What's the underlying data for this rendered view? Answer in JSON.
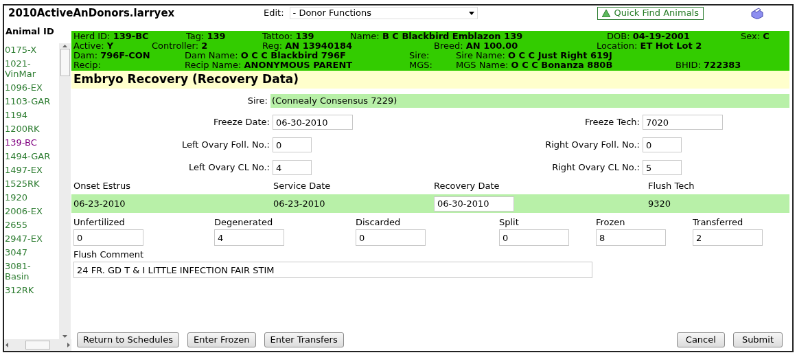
{
  "window": {
    "title": "2010ActiveAnDonors.larryex"
  },
  "edit_menu": {
    "label": "Edit:",
    "value": "- Donor Functions"
  },
  "quick_find": {
    "label": "Quick Find Animals"
  },
  "sidebar": {
    "heading": "Animal ID",
    "items": [
      {
        "label": "0175-X",
        "selected": false
      },
      {
        "label": "1021-VinMar",
        "selected": false
      },
      {
        "label": "1096-EX",
        "selected": false
      },
      {
        "label": "1103-GAR",
        "selected": false
      },
      {
        "label": "1194",
        "selected": false
      },
      {
        "label": "1200RK",
        "selected": false
      },
      {
        "label": "139-BC",
        "selected": true
      },
      {
        "label": "1494-GAR",
        "selected": false
      },
      {
        "label": "1497-EX",
        "selected": false
      },
      {
        "label": "1525RK",
        "selected": false
      },
      {
        "label": "1920",
        "selected": false
      },
      {
        "label": "2006-EX",
        "selected": false
      },
      {
        "label": "2655",
        "selected": false
      },
      {
        "label": "2947-EX",
        "selected": false
      },
      {
        "label": "3047",
        "selected": false
      },
      {
        "label": "3081-Basin",
        "selected": false
      },
      {
        "label": "312RK",
        "selected": false
      }
    ]
  },
  "animal_header": [
    [
      {
        "label": "Herd ID:",
        "value": "139-BC"
      },
      {
        "label": "Tag:",
        "value": "139"
      },
      {
        "label": "Tattoo:",
        "value": "139"
      },
      {
        "label": "Name:",
        "value": "B C Blackbird Emblazon 139"
      },
      {
        "label": "DOB:",
        "value": "04-19-2001"
      },
      {
        "label": "Sex:",
        "value": "C"
      }
    ],
    [
      {
        "label": "Active:",
        "value": "Y"
      },
      {
        "label": "Controller:",
        "value": "2"
      },
      {
        "label": "Reg:",
        "value": "AN 13940184"
      },
      {
        "label": "Breed:",
        "value": "AN 100.00"
      },
      {
        "label": "Location:",
        "value": "ET Hot Lot 2"
      }
    ],
    [
      {
        "label": "Dam:",
        "value": "796F-CON"
      },
      {
        "label": "Dam Name:",
        "value": "O C C Blackbird 796F"
      },
      {
        "label": "Sire:"
      },
      {
        "label": "Sire Name:",
        "value": "O C C Just Right 619J"
      }
    ],
    [
      {
        "label": "Recip:"
      },
      {
        "label": "Recip Name:",
        "value": "ANONYMOUS PARENT"
      },
      {
        "label": "MGS:"
      },
      {
        "label": "MGS Name:",
        "value": "O C C Bonanza 880B"
      },
      {
        "label": "BHID:",
        "value": "722383"
      }
    ]
  ],
  "section_title": "Embryo Recovery (Recovery Data)",
  "sire": {
    "label": "Sire:",
    "value": "(Connealy Consensus 7229)"
  },
  "field_pairs": [
    [
      {
        "label": "Freeze Date:",
        "value": "06-30-2010"
      },
      {
        "label": "Freeze Tech:",
        "value": "7020"
      }
    ],
    [
      {
        "label": "Left Ovary Foll. No.:",
        "value": "0"
      },
      {
        "label": "Right Ovary Foll. No.:",
        "value": "0"
      }
    ],
    [
      {
        "label": "Left Ovary CL No.:",
        "value": "4"
      },
      {
        "label": "Right Ovary CL No.:",
        "value": "5"
      }
    ]
  ],
  "dates": [
    {
      "label": "Onset Estrus",
      "value": "06-23-2010",
      "kind": "text"
    },
    {
      "label": "Service Date",
      "value": "06-23-2010",
      "kind": "text"
    },
    {
      "label": "Recovery Date",
      "value": "06-30-2010",
      "kind": "input"
    },
    {
      "label": "Flush Tech",
      "value": "9320",
      "kind": "text"
    }
  ],
  "counts": [
    {
      "label": "Unfertilized",
      "value": "0"
    },
    {
      "label": "Degenerated",
      "value": "4"
    },
    {
      "label": "Discarded",
      "value": "0"
    },
    {
      "label": "Split",
      "value": "0"
    },
    {
      "label": "Frozen",
      "value": "8"
    },
    {
      "label": "Transferred",
      "value": "2"
    }
  ],
  "flush_comment": {
    "label": "Flush Comment",
    "value": "24 FR. GD T & I LITTLE INFECTION FAIR STIM"
  },
  "buttons_left": [
    "Return to Schedules",
    "Enter Frozen",
    "Enter Transfers"
  ],
  "buttons_right": [
    "Cancel",
    "Submit"
  ]
}
